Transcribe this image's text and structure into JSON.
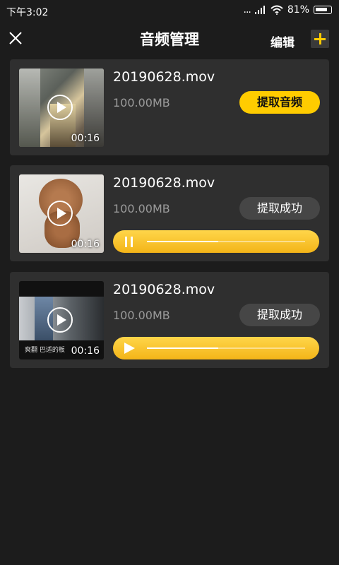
{
  "status_bar": {
    "time": "下午3:02",
    "signal_dots": "...",
    "battery_pct": "81%"
  },
  "header": {
    "title": "音频管理",
    "edit_label": "编辑"
  },
  "items": [
    {
      "filename": "20190628.mov",
      "size": "100.00MB",
      "duration": "00:16",
      "action_label": "提取音频",
      "state": "not_extracted"
    },
    {
      "filename": "20190628.mov",
      "size": "100.00MB",
      "duration": "00:16",
      "action_label": "提取成功",
      "state": "playing",
      "progress": 0.45
    },
    {
      "filename": "20190628.mov",
      "size": "100.00MB",
      "duration": "00:16",
      "action_label": "提取成功",
      "state": "paused",
      "progress": 0.45,
      "thumb_caption": "爽翻  巴适的板"
    }
  ],
  "colors": {
    "accent": "#ffcc00",
    "background": "#1c1c1c",
    "card": "#2f2f2f",
    "muted_text": "#9a9a9a"
  },
  "icons": [
    "close-icon",
    "add-icon",
    "play-icon",
    "pause-icon",
    "wifi-icon",
    "signal-icon",
    "battery-icon"
  ]
}
